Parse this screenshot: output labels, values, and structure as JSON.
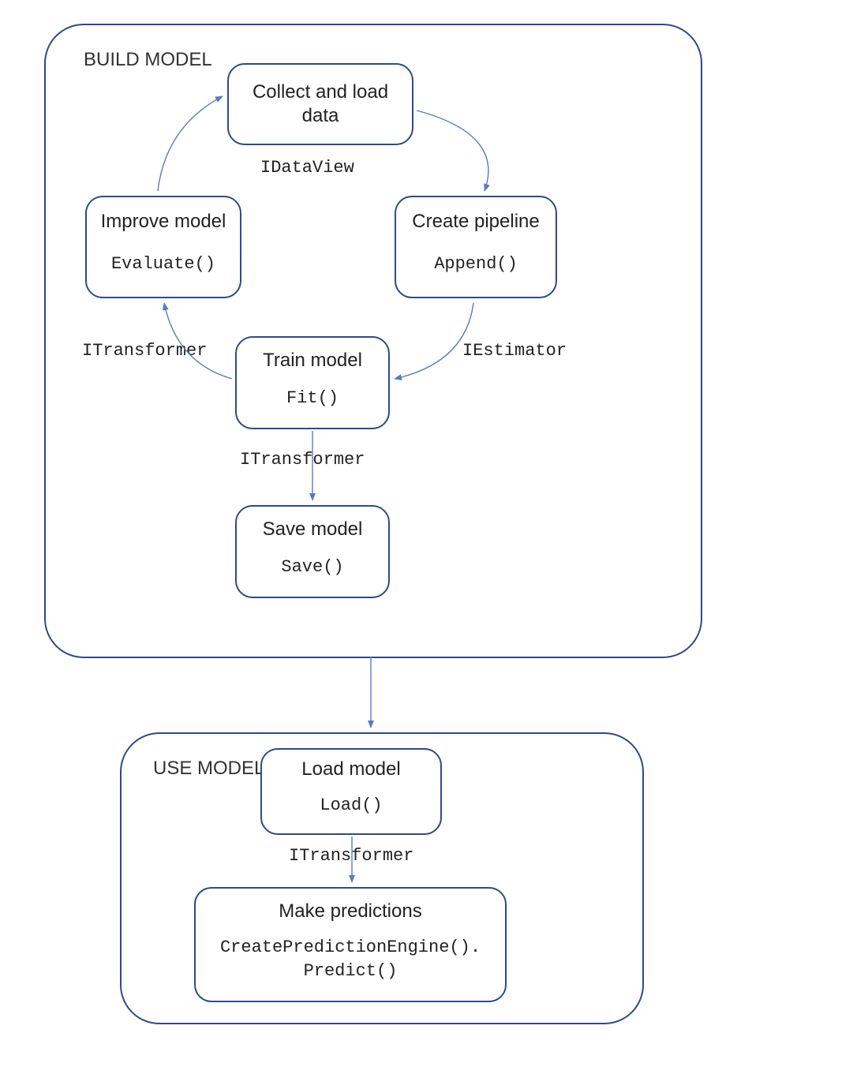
{
  "build": {
    "label": "BUILD MODEL",
    "nodes": {
      "collect": {
        "title": "Collect and load data",
        "method": ""
      },
      "pipeline": {
        "title": "Create pipeline",
        "method": "Append()"
      },
      "improve": {
        "title": "Improve model",
        "method": "Evaluate()"
      },
      "train": {
        "title": "Train model",
        "method": "Fit()"
      },
      "save": {
        "title": "Save model",
        "method": "Save()"
      }
    },
    "edges": {
      "collect_to_pipeline": "IDataView",
      "pipeline_to_train": "IEstimator",
      "train_to_improve": "ITransformer",
      "train_to_save": "ITransformer"
    }
  },
  "use": {
    "label": "USE MODEL",
    "nodes": {
      "load": {
        "title": "Load model",
        "method": "Load()"
      },
      "predict": {
        "title": "Make predictions",
        "method": "CreatePredictionEngine().\nPredict()"
      }
    },
    "edges": {
      "load_to_predict": "ITransformer"
    }
  }
}
